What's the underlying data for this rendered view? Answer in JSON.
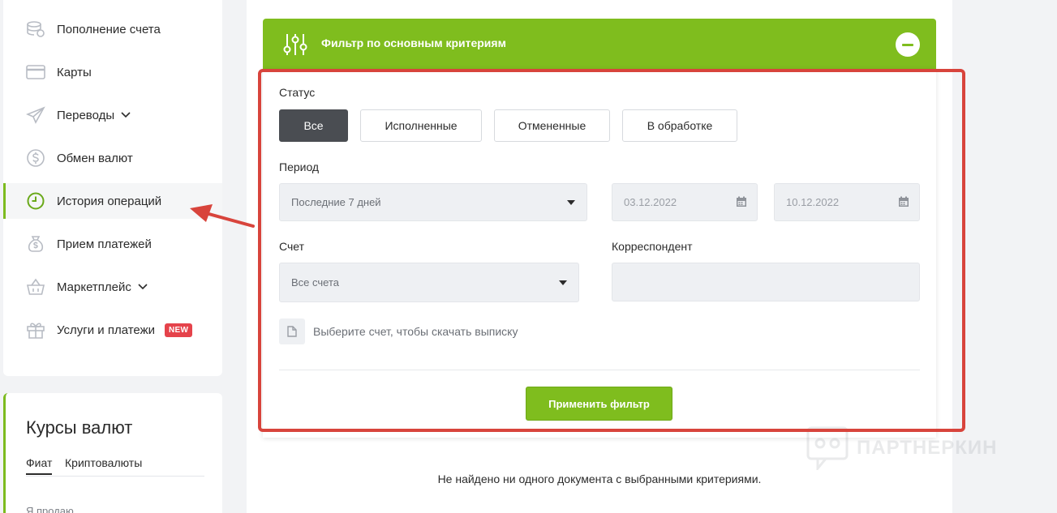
{
  "sidebar": {
    "items": [
      {
        "label": "Пополнение счета",
        "icon": "coins-icon"
      },
      {
        "label": "Карты",
        "icon": "card-icon"
      },
      {
        "label": "Переводы",
        "icon": "paper-plane-icon",
        "has_submenu": true
      },
      {
        "label": "Обмен валют",
        "icon": "dollar-exchange-icon"
      },
      {
        "label": "История операций",
        "icon": "clock-icon",
        "active": true
      },
      {
        "label": "Прием платежей",
        "icon": "money-bag-icon"
      },
      {
        "label": "Маркетплейс",
        "icon": "basket-icon",
        "has_submenu": true
      },
      {
        "label": "Услуги и платежи",
        "icon": "gift-icon",
        "badge": "NEW"
      }
    ]
  },
  "rates": {
    "title": "Курсы валют",
    "tabs": [
      "Фиат",
      "Криптовалюты"
    ],
    "active_tab": "Фиат",
    "sub_label": "Я продаю"
  },
  "filter": {
    "title": "Фильтр по основным критериям",
    "status_label": "Статус",
    "status_options": [
      "Все",
      "Исполненные",
      "Отмененные",
      "В обработке"
    ],
    "status_selected": "Все",
    "period_label": "Период",
    "period_value": "Последние 7 дней",
    "date_from": "03.12.2022",
    "date_to": "10.12.2022",
    "account_label": "Счет",
    "account_value": "Все счета",
    "correspondent_label": "Корреспондент",
    "correspondent_value": "",
    "statement_hint": "Выберите счет, чтобы скачать выписку",
    "apply_label": "Применить фильтр"
  },
  "results": {
    "empty_message": "Не найдено ни одного документа с выбранными критериями."
  },
  "watermark": {
    "text": "ПАРТНЕРКИН"
  },
  "colors": {
    "accent_green": "#7fbd1e",
    "active_button": "#4a4d52",
    "annotation_red": "#d8443c",
    "badge_red": "#e5434b"
  }
}
